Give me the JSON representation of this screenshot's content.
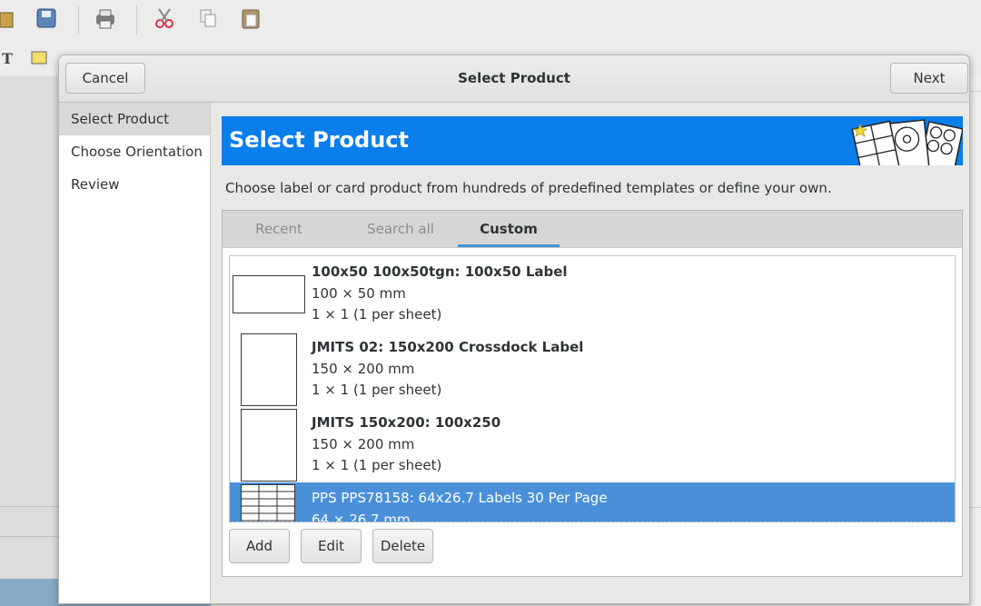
{
  "dialog": {
    "title": "Select Product",
    "cancel_label": "Cancel",
    "next_label": "Next"
  },
  "sidebar": {
    "items": [
      {
        "label": "Select Product",
        "active": true
      },
      {
        "label": "Choose Orientation",
        "active": false
      },
      {
        "label": "Review",
        "active": false
      }
    ]
  },
  "page": {
    "banner_title": "Select Product",
    "description": "Choose label or card product from hundreds of predefined templates or define your own."
  },
  "tabs": [
    {
      "label": "Recent",
      "active": false
    },
    {
      "label": "Search all",
      "active": false
    },
    {
      "label": "Custom",
      "active": true
    }
  ],
  "products": [
    {
      "name": "100x50 100x50tgn: 100x50 Label",
      "dims": "100 × 50 mm",
      "layout": "1 × 1 (1 per sheet)",
      "selected": false
    },
    {
      "name": "JMITS 02: 150x200 Crossdock Label",
      "dims": "150 × 200 mm",
      "layout": "1 × 1 (1 per sheet)",
      "selected": false
    },
    {
      "name": "JMITS 150x200: 100x250",
      "dims": "150 × 200 mm",
      "layout": "1 × 1 (1 per sheet)",
      "selected": false
    },
    {
      "name": "PPS PPS78158: 64x26.7 Labels 30 Per Page",
      "dims": "64 × 26.7 mm",
      "layout": "",
      "selected": true
    }
  ],
  "actions": {
    "add_label": "Add",
    "edit_label": "Edit",
    "delete_label": "Delete"
  },
  "colors": {
    "accent": "#4a90d9",
    "banner": "#0a7eea"
  }
}
